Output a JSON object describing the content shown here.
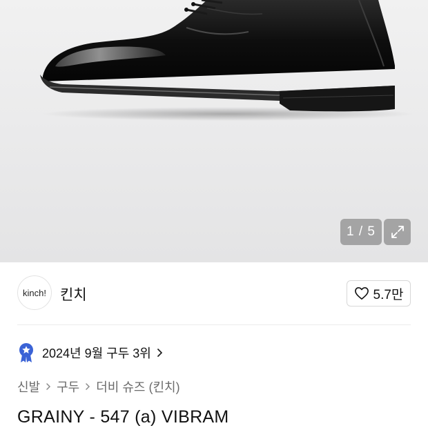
{
  "gallery": {
    "counter": "1 / 5",
    "expand_icon": "expand-icon"
  },
  "brand": {
    "logo_text": "kinch!",
    "name": "킨치",
    "like_count": "5.7만",
    "like_icon": "heart-icon"
  },
  "ranking": {
    "text": "2024년 9월 구두 3위",
    "badge_color": "#3b63d6"
  },
  "breadcrumb": {
    "items": [
      "신발",
      "구두",
      "더비 슈즈 (킨치)"
    ]
  },
  "product": {
    "title": "GRAINY - 547 (a) VIBRAM"
  }
}
